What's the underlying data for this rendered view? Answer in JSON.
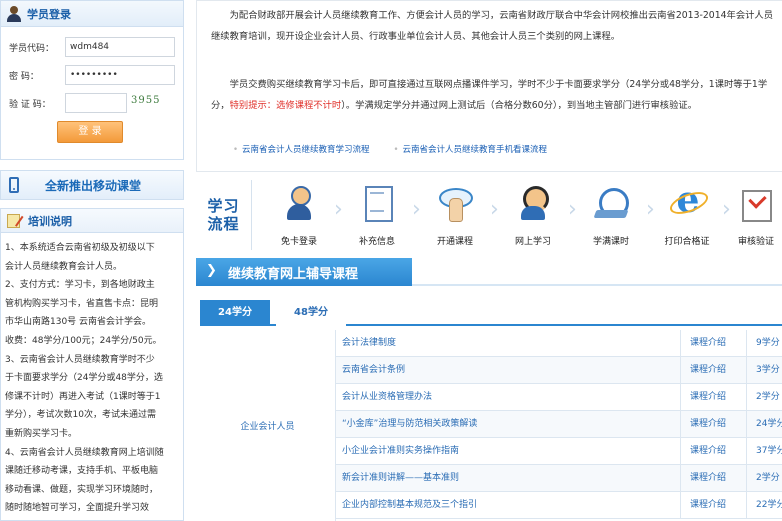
{
  "login": {
    "title": "学员登录",
    "code_label": "学员代码：",
    "code_value": "wdm484",
    "password_label": "密    码：",
    "password_value": "•••••••••",
    "captcha_label": "验 证 码：",
    "captcha_value": "",
    "captcha_image_text": "3955",
    "submit_label": "登 录"
  },
  "mobile": {
    "label": "全新推出移动课堂"
  },
  "training": {
    "title": "培训说明",
    "lines": [
      "1、本系统适合云南省初级及初级以下",
      "会计人员继续教育会计人员。",
      "2、支付方式：学习卡，到各地财政主",
      "管机构购买学习卡，省直售卡点：昆明",
      "市华山南路130号  云南省会计学会。",
      "收费：48学分/100元；24学分/50元。",
      "3、云南省会计人员继续教育学时不少",
      "于卡面要求学分（24学分或48学分，选",
      "修课不计时）再进入考试（1课时等于1",
      "学分），考试次数10次，考试未通过需",
      "重新购买学习卡。",
      "4、云南省会计人员继续教育网上培训随",
      "课随迁移动考课，支持手机、平板电脑",
      "移动看课、做题，实现学习环境随时，",
      "随时随地智可学习，全面提升学习效"
    ]
  },
  "intro": {
    "p1": "为配合财政部开展会计人员继续教育工作、方便会计人员的学习，云南省财政厅联合中华会计网校推出云南省2013-2014年会计人员继续教育培训，现开设企业会计人员、行政事业单位会计人员、其他会计人员三个类别的网上课程。",
    "p2_a": "学员交费购买继续教育学习卡后，即可直接通过互联网点播课件学习，学时不少于卡面要求学分（24学分或48学分，1课时等于1学分，",
    "p2_red": "特别提示：选修课程不计时",
    "p2_b": "）。学满规定学分并通过网上测试后（合格分数60分），到当地主管部门进行审核验证。",
    "link1": "云南省会计人员继续教育学习流程",
    "link2": "云南省会计人员继续教育手机看课流程"
  },
  "flow": {
    "head_line1": "学习",
    "head_line2": "流程",
    "steps": [
      {
        "label": "免卡登录",
        "icon": "person-icon"
      },
      {
        "label": "补充信息",
        "icon": "form-icon"
      },
      {
        "label": "开通课程",
        "icon": "hand-click-icon"
      },
      {
        "label": "网上学习",
        "icon": "headset-icon"
      },
      {
        "label": "学满课时",
        "icon": "clock-icon"
      },
      {
        "label": "打印合格证",
        "icon": "ie-icon"
      },
      {
        "label": "审核验证",
        "icon": "check-icon"
      }
    ]
  },
  "courses": {
    "header": "继续教育网上辅导课程",
    "tabs": [
      "24学分",
      "48学分"
    ],
    "category": "企业会计人员",
    "intro_label": "课程介绍",
    "rows": [
      {
        "name": "会计法律制度",
        "credit": "9学分"
      },
      {
        "name": "云南省会计条例",
        "credit": "3学分"
      },
      {
        "name": "会计从业资格管理办法",
        "credit": "2学分"
      },
      {
        "name": "“小金库”治理与防范相关政策解读",
        "credit": "24学分"
      },
      {
        "name": "小企业会计准则实务操作指南",
        "credit": "37学分"
      },
      {
        "name": "新会计准则讲解——基本准则",
        "credit": "2学分"
      },
      {
        "name": "企业内部控制基本规范及三个指引",
        "credit": "22学分"
      }
    ]
  }
}
